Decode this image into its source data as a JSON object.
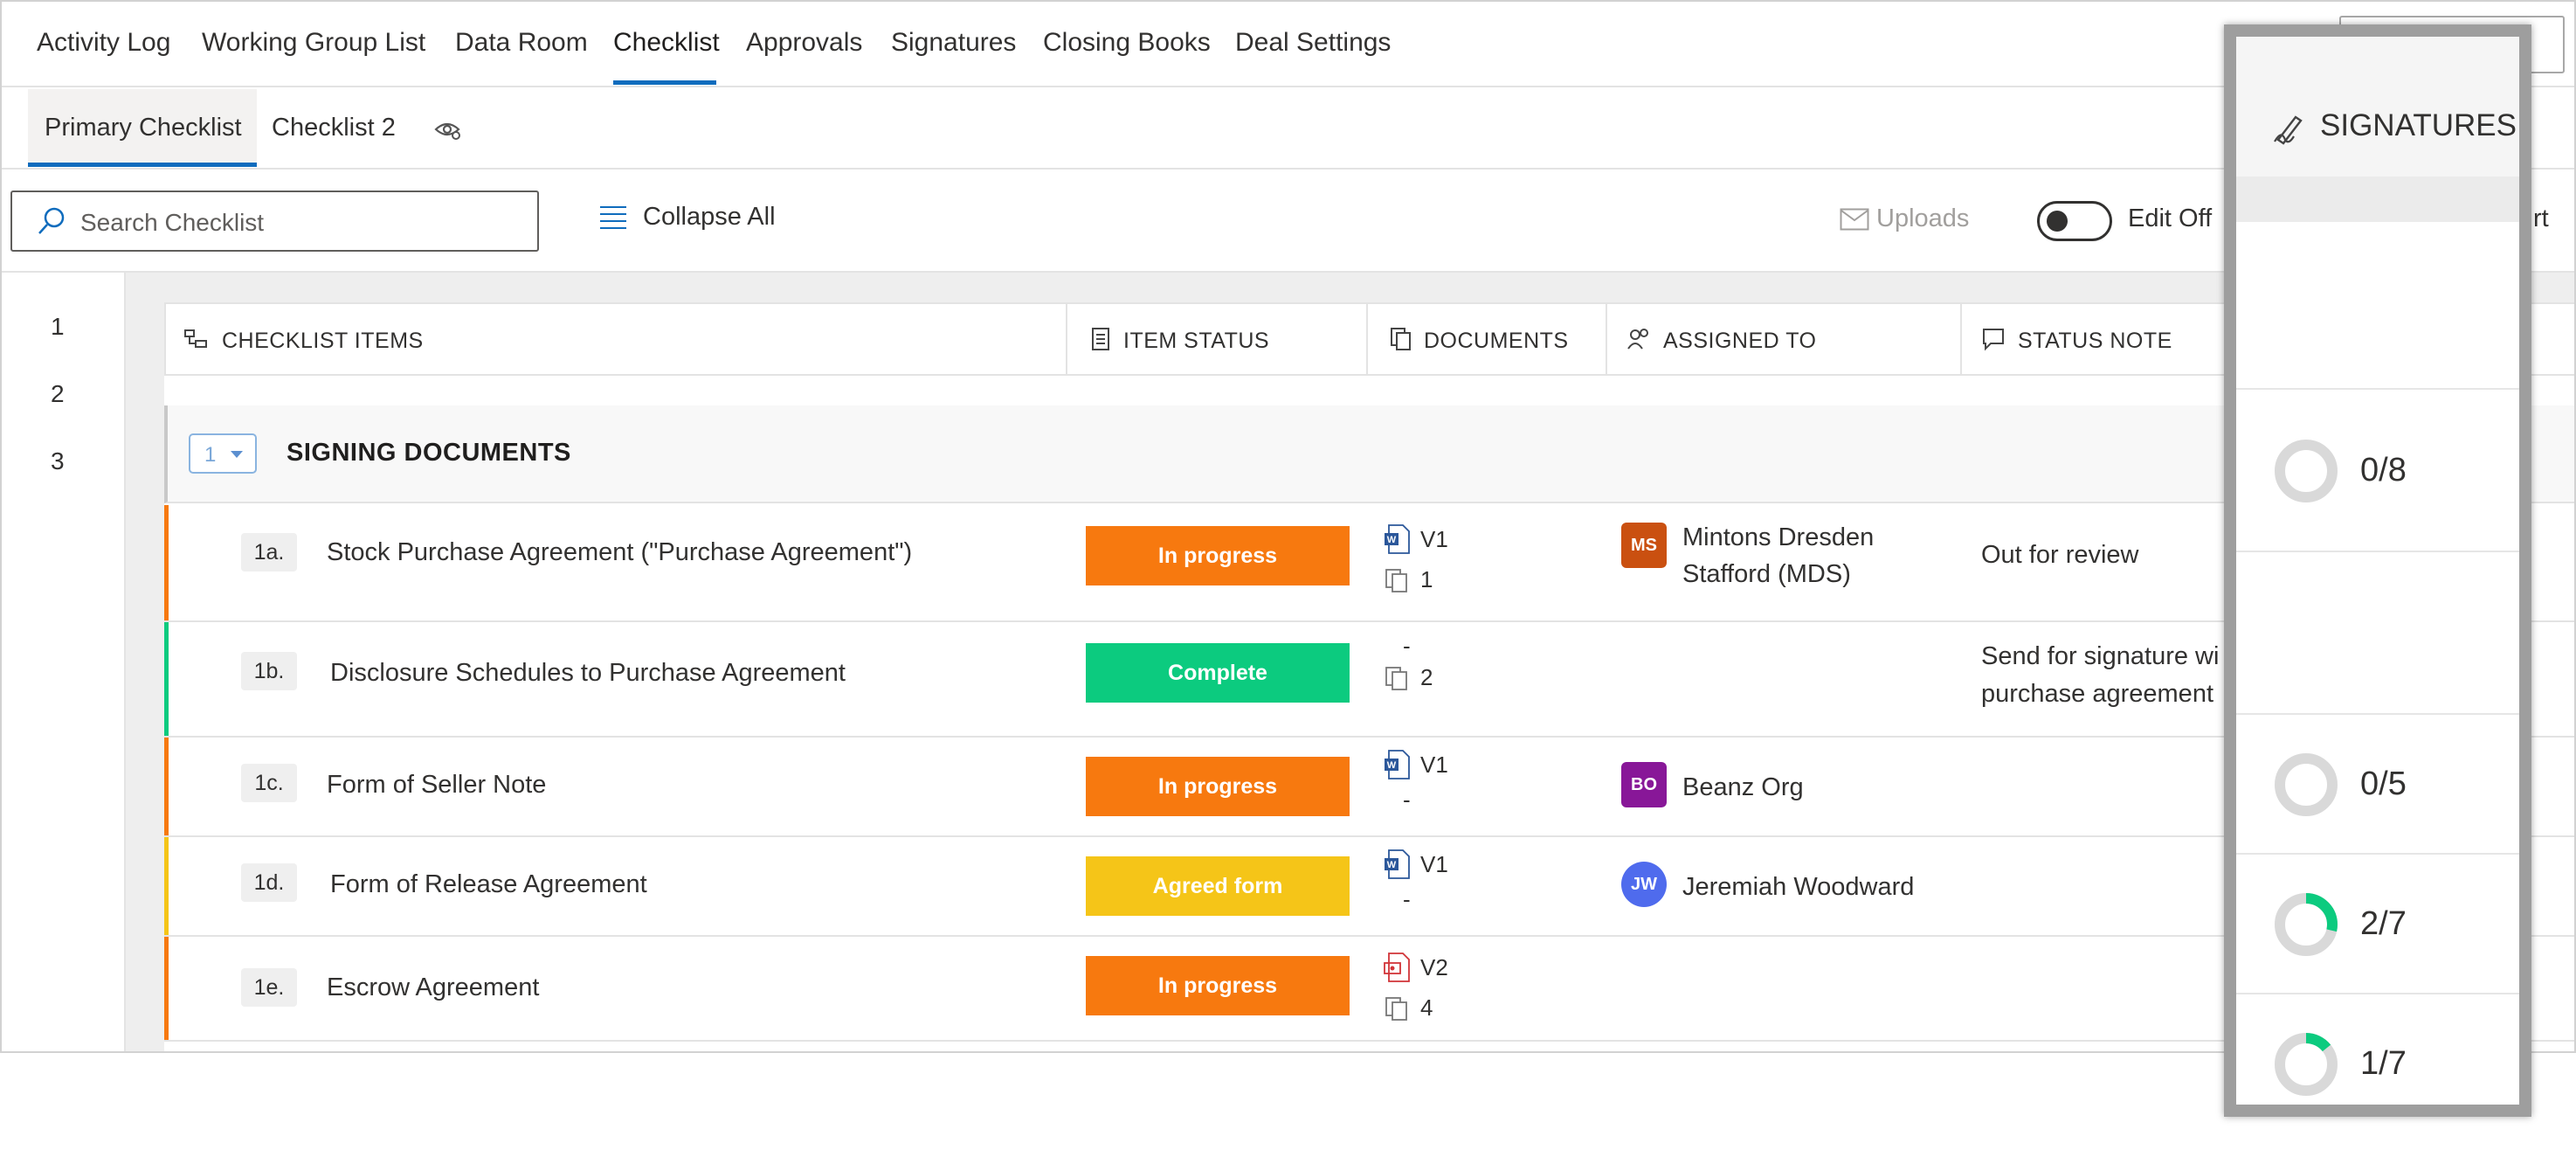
{
  "nav": {
    "items": [
      "Activity Log",
      "Working Group List",
      "Data Room",
      "Checklist",
      "Approvals",
      "Signatures",
      "Closing Books",
      "Deal Settings"
    ],
    "active": "Checklist"
  },
  "subtabs": {
    "items": [
      "Primary Checklist",
      "Checklist 2"
    ],
    "active": "Primary Checklist"
  },
  "toolbar": {
    "search_placeholder": "Search Checklist",
    "collapse_label": "Collapse All",
    "uploads_label": "Uploads",
    "edit_label": "Edit Off",
    "edit_on": false,
    "right_cut_label": "rt"
  },
  "gutter": [
    "1",
    "2",
    "3"
  ],
  "columns": [
    "CHECKLIST ITEMS",
    "ITEM STATUS",
    "DOCUMENTS",
    "ASSIGNED TO",
    "STATUS NOTE"
  ],
  "section": {
    "number": "1",
    "title": "SIGNING DOCUMENTS"
  },
  "rows": [
    {
      "num": "1a.",
      "name": "Stock Purchase Agreement (\"Purchase Agreement\")",
      "status": "In progress",
      "status_color": "#f7790f",
      "bar_color": "#f7790f",
      "docs": [
        {
          "icon": "word-doc-icon",
          "text": "V1"
        },
        {
          "icon": "copies-icon",
          "text": "1"
        }
      ],
      "assignee": {
        "initials": "MS",
        "name_lines": [
          "Mintons Dresden",
          "Stafford (MDS)"
        ],
        "color": "#ca5010",
        "shape": "square"
      },
      "note": [
        "Out for review"
      ]
    },
    {
      "num": "1b.",
      "name": "Disclosure Schedules to Purchase Agreement",
      "status": "Complete",
      "status_color": "#0ccb7f",
      "bar_color": "#0ccb7f",
      "docs": [
        {
          "icon": "none",
          "text": "-"
        },
        {
          "icon": "copies-icon",
          "text": "2"
        }
      ],
      "assignee": null,
      "note": [
        "Send for signature wi",
        "purchase agreement"
      ]
    },
    {
      "num": "1c.",
      "name": "Form of Seller Note",
      "status": "In progress",
      "status_color": "#f7790f",
      "bar_color": "#f7790f",
      "docs": [
        {
          "icon": "word-doc-icon",
          "text": "V1"
        },
        {
          "icon": "none",
          "text": "-"
        }
      ],
      "assignee": {
        "initials": "BO",
        "name_lines": [
          "Beanz Org"
        ],
        "color": "#881798",
        "shape": "square"
      },
      "note": []
    },
    {
      "num": "1d.",
      "name": "Form of Release Agreement",
      "status": "Agreed form",
      "status_color": "#f5c518",
      "bar_color": "#f5c518",
      "docs": [
        {
          "icon": "word-doc-icon",
          "text": "V1"
        },
        {
          "icon": "none",
          "text": "-"
        }
      ],
      "assignee": {
        "initials": "JW",
        "name_lines": [
          "Jeremiah Woodward"
        ],
        "color": "#4f6bed",
        "shape": "round"
      },
      "note": []
    },
    {
      "num": "1e.",
      "name": "Escrow Agreement",
      "status": "In progress",
      "status_color": "#f7790f",
      "bar_color": "#f7790f",
      "docs": [
        {
          "icon": "pdf-doc-icon",
          "text": "V2"
        },
        {
          "icon": "copies-icon",
          "text": "4"
        }
      ],
      "assignee": null,
      "note": []
    }
  ],
  "signatures": {
    "title": "SIGNATURES",
    "cells": [
      {
        "label": "",
        "done": 0,
        "total": 0
      },
      {
        "label": "0/8",
        "done": 0,
        "total": 8
      },
      {
        "label": "",
        "done": 0,
        "total": 0
      },
      {
        "label": "0/5",
        "done": 0,
        "total": 5
      },
      {
        "label": "2/7",
        "done": 2,
        "total": 7
      },
      {
        "label": "1/7",
        "done": 1,
        "total": 7
      }
    ]
  },
  "colors": {
    "accent": "#0f6cbd",
    "progress_green": "#0ccb7f",
    "donut_track": "#d9d9d9"
  }
}
